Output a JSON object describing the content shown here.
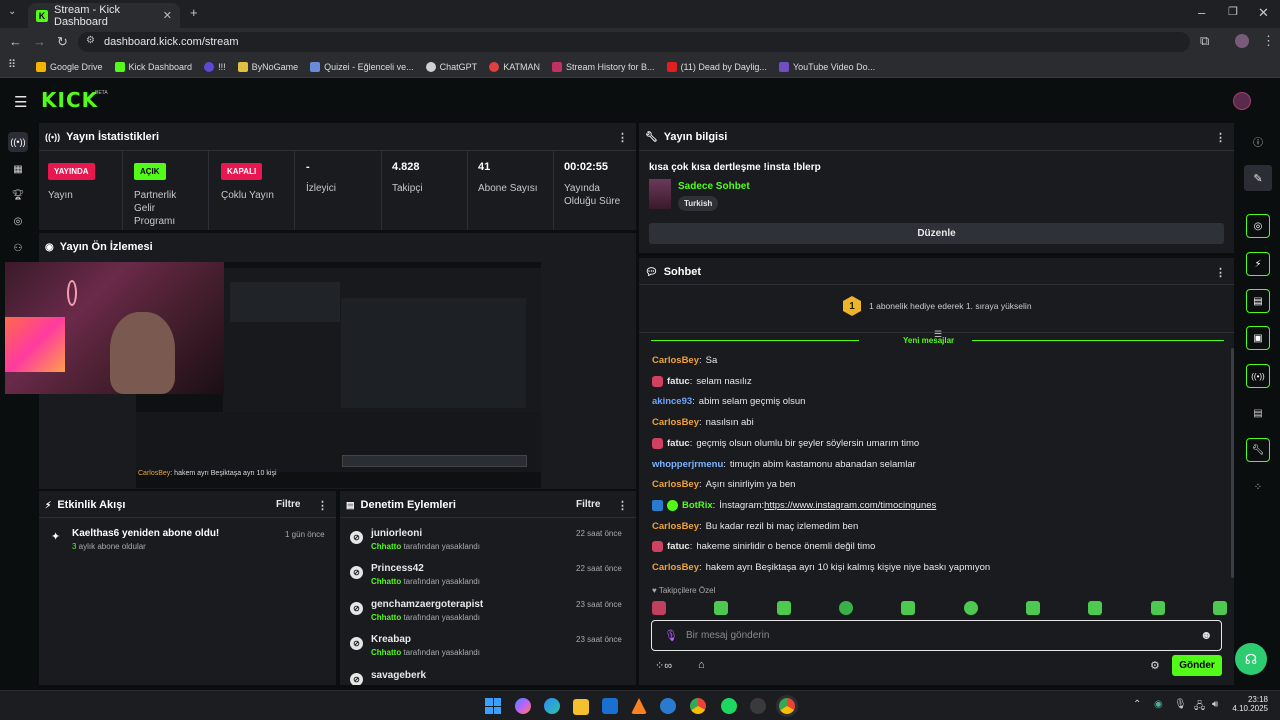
{
  "browser": {
    "tab_title": "Stream - Kick Dashboard",
    "url": "dashboard.kick.com/stream",
    "bookmarks": [
      "Google Drive",
      "Kick Dashboard",
      "!!!",
      "ByNoGame",
      "Quizei - Eğlenceli ve...",
      "ChatGPT",
      "KATMAN",
      "Stream History for B...",
      "(11) Dead by Daylig...",
      "YouTube Video Do..."
    ]
  },
  "header": {
    "logo": "KICK",
    "beta": "BETA"
  },
  "stats": {
    "title": "Yayın İstatistikleri",
    "live_badge": "YAYINDA",
    "live_label": "Yayın",
    "partner_badge": "AÇIK",
    "partner_label": [
      "Partnerlik",
      "Gelir",
      "Programı"
    ],
    "multi_badge": "KAPALI",
    "multi_label": "Çoklu Yayın",
    "viewers_value": "-",
    "viewers_label": "İzleyici",
    "followers_value": "4.828",
    "followers_label": "Takipçi",
    "subs_value": "41",
    "subs_label": "Abone Sayısı",
    "duration_value": "00:02:55",
    "duration_label": [
      "Yayında",
      "Olduğu Süre"
    ]
  },
  "preview": {
    "title": "Yayın Ön İzlemesi",
    "overlay_user": "CarlosBey",
    "overlay_text": ": hakem ayrı Beşiktaşa ayrı 10 kişi"
  },
  "activity": {
    "title": "Etkinlik Akışı",
    "filter": "Filtre",
    "items": [
      {
        "title": "Kaelthas6 yeniden abone oldu!",
        "count": "3",
        "sub": " aylık abone oldular",
        "time": "1 gün önce"
      }
    ]
  },
  "moderation": {
    "title": "Denetim Eylemleri",
    "filter": "Filtre",
    "by": "Chhatto",
    "action": " tarafından yasaklandı",
    "items": [
      {
        "user": "juniorleoni",
        "time": "22 saat önce"
      },
      {
        "user": "Princess42",
        "time": "22 saat önce"
      },
      {
        "user": "genchamzaergoterapist",
        "time": "23 saat önce"
      },
      {
        "user": "Kreabap",
        "time": "23 saat önce"
      },
      {
        "user": "savageberk",
        "time": ""
      }
    ]
  },
  "stream_info": {
    "title": "Yayın bilgisi",
    "stream_title": "kısa çok kısa dertleşme !insta !blerp",
    "category": "Sadece Sohbet",
    "tag": "Turkish",
    "edit": "Düzenle"
  },
  "chat": {
    "title": "Sohbet",
    "gift_rank": "1",
    "gift_text": "1 abonelik hediye ederek 1. sıraya yükselin",
    "new_messages": "Yeni mesajlar",
    "messages": [
      {
        "user": "CarlosBey",
        "color": "#f0a23b",
        "text": "Sa",
        "badge": false,
        "bot": false
      },
      {
        "user": "fatuc",
        "color": "#e8e8e8",
        "text": "selam nasılız",
        "badge": true,
        "bot": false
      },
      {
        "user": "akince93",
        "color": "#6ba5ff",
        "text": "abim selam geçmiş olsun",
        "badge": false,
        "bot": false
      },
      {
        "user": "CarlosBey",
        "color": "#f0a23b",
        "text": "nasılsın abi",
        "badge": false,
        "bot": false
      },
      {
        "user": "fatuc",
        "color": "#e8e8e8",
        "text": "geçmiş olsun olumlu bir şeyler söylersin umarım timo",
        "badge": true,
        "bot": false
      },
      {
        "user": "whopperjrmenu",
        "color": "#7db3ff",
        "text": "timuçin abim kastamonu abanadan selamlar",
        "badge": false,
        "bot": false
      },
      {
        "user": "CarlosBey",
        "color": "#f0a23b",
        "text": "Aşırı sinirliyim ya ben",
        "badge": false,
        "bot": false
      },
      {
        "user": "BotRix",
        "color": "#53fc18",
        "text": "İnstagram: ",
        "link": "https://www.instagram.com/timocingunes",
        "badge": false,
        "bot": true
      },
      {
        "user": "CarlosBey",
        "color": "#f0a23b",
        "text": "Bu kadar rezil bi maç izlemedim ben",
        "badge": false,
        "bot": false
      },
      {
        "user": "fatuc",
        "color": "#e8e8e8",
        "text": "hakeme sinirlidir o bence önemli değil timo",
        "badge": true,
        "bot": false
      },
      {
        "user": "CarlosBey",
        "color": "#f0a23b",
        "text": "hakem ayrı Beşiktaşa ayrı 10 kişi kalmış kişiye niye baskı yapmıyon",
        "badge": false,
        "bot": false
      }
    ],
    "emote_section": "Takipçilere Özel",
    "input_placeholder": "Bir mesaj gönderin",
    "send": "Gönder"
  },
  "taskbar": {
    "time": "23:18",
    "date": "4.10.2025"
  },
  "colors": {
    "accent": "#53fc18",
    "live": "#e8174f",
    "panel": "#191b1f"
  }
}
